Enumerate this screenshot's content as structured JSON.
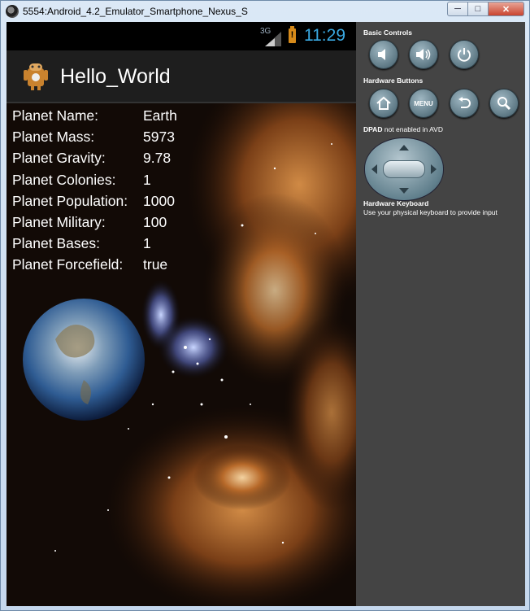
{
  "window": {
    "title": "5554:Android_4.2_Emulator_Smartphone_Nexus_S"
  },
  "statusbar": {
    "network": "3G",
    "battery_alert": "!",
    "time": "11:29"
  },
  "app": {
    "title": "Hello_World"
  },
  "planet": [
    {
      "label": "Planet Name:",
      "value": "Earth"
    },
    {
      "label": "Planet Mass:",
      "value": "5973"
    },
    {
      "label": "Planet Gravity:",
      "value": "9.78"
    },
    {
      "label": "Planet Colonies:",
      "value": "1"
    },
    {
      "label": "Planet Population:",
      "value": "1000"
    },
    {
      "label": "Planet Military:",
      "value": "100"
    },
    {
      "label": "Planet Bases:",
      "value": "1"
    },
    {
      "label": "Planet Forcefield:",
      "value": "true"
    }
  ],
  "panel": {
    "basic_controls_label": "Basic Controls",
    "hardware_buttons_label": "Hardware Buttons",
    "menu_label": "MENU",
    "dpad_label": "DPAD",
    "dpad_note": "not enabled in AVD",
    "keyboard_label": "Hardware Keyboard",
    "keyboard_note": "Use your physical keyboard to provide input"
  },
  "colors": {
    "accent_time": "#3aa9e2",
    "panel_bg": "#444444"
  }
}
